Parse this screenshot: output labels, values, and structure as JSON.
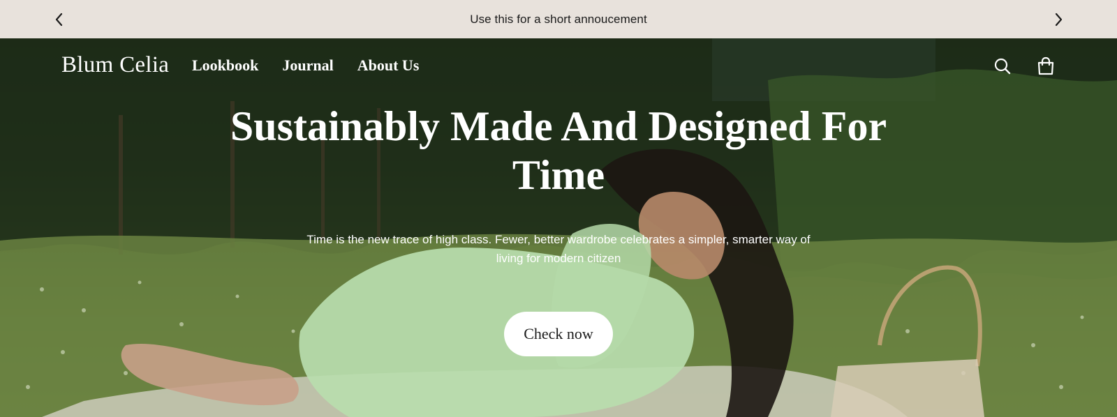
{
  "announcement": {
    "text": "Use this for a short annoucement",
    "prev_icon": "chevron-left-icon",
    "next_icon": "chevron-right-icon"
  },
  "header": {
    "logo": "Blum Celia",
    "nav": [
      {
        "label": "Lookbook"
      },
      {
        "label": "Journal"
      },
      {
        "label": "About Us"
      }
    ],
    "icons": [
      "search-icon",
      "shopping-bag-icon"
    ]
  },
  "hero": {
    "headline_line1": "Sustainably Made And Designed For",
    "headline_line2": "Time",
    "subtext": "Time is the new trace of high class. Fewer, better wardrobe celebrates a simpler, smarter way of living for modern citizen",
    "cta_label": "Check now"
  },
  "colors": {
    "announcement_bg": "#e8e2dc",
    "text_light": "#ffffff",
    "button_bg": "#ffffff"
  }
}
